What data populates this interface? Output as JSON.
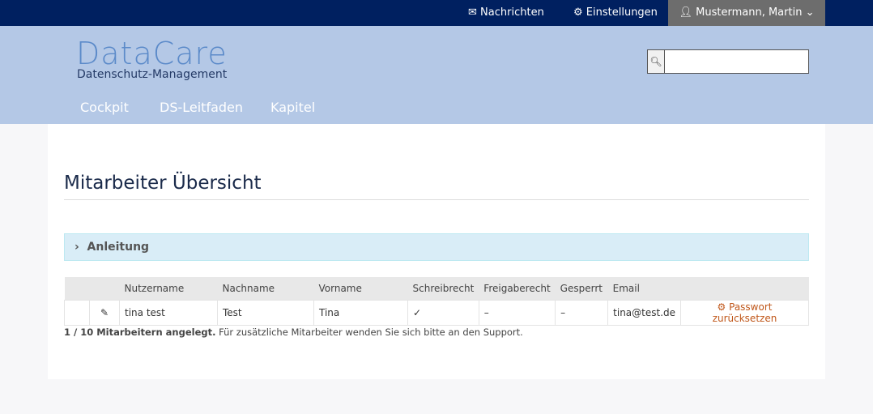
{
  "topbar": {
    "messages": "Nachrichten",
    "settings": "Einstellungen",
    "user": "Mustermann, Martin"
  },
  "logo": {
    "title": "DataCare",
    "subtitle": "Datenschutz-Management"
  },
  "nav": [
    "Cockpit",
    "DS-Leitfaden",
    "Kapitel"
  ],
  "page": {
    "title": "Mitarbeiter Übersicht",
    "panel": "Anleitung"
  },
  "table": {
    "headers": [
      "Nutzername",
      "Nachname",
      "Vorname",
      "Schreibrecht",
      "Freigaberecht",
      "Gesperrt",
      "Email"
    ],
    "rows": [
      {
        "username": "tina test",
        "lastname": "Test",
        "firstname": "Tina",
        "write": "✓",
        "share": "–",
        "locked": "–",
        "email": "tina@test.de",
        "action": "Passwort zurücksetzen"
      }
    ]
  },
  "note": {
    "bold": "1 / 10 Mitarbeitern angelegt.",
    "text": " Für zusätzliche Mitarbeiter wenden Sie sich bitte an den Support."
  }
}
